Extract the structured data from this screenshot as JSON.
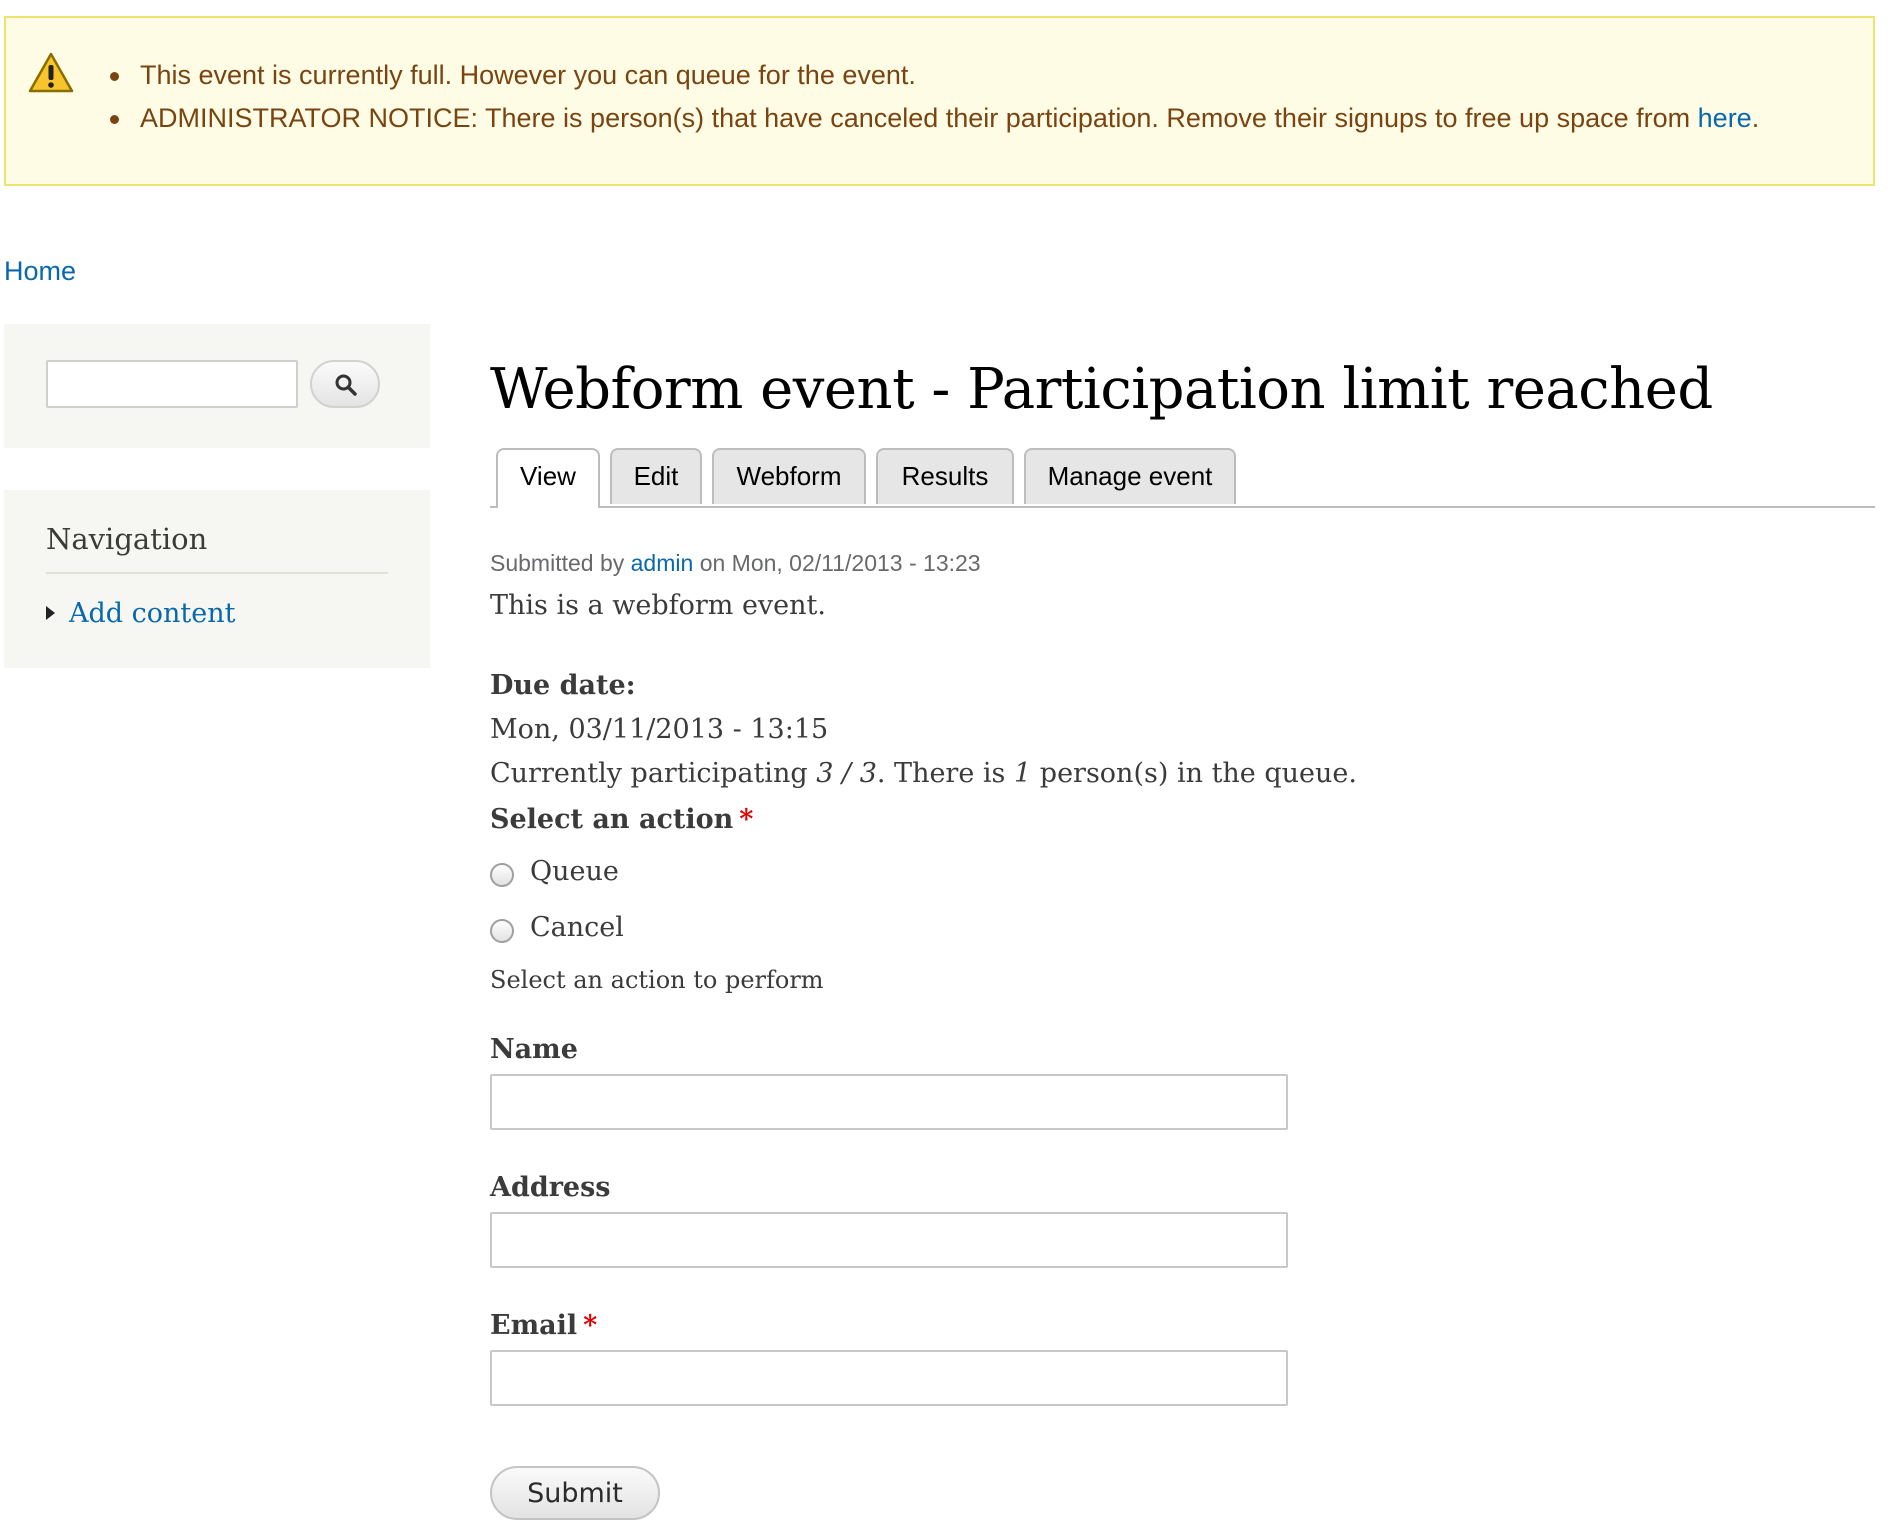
{
  "messages": {
    "type": "warning",
    "icon": "warning-icon",
    "items": [
      "This event is currently full. However you can queue for the event.",
      "ADMINISTRATOR NOTICE: There is person(s) that have canceled their participation. Remove their signups to free up space from"
    ],
    "link_text": "here",
    "after_link": "."
  },
  "breadcrumb": {
    "home": "Home"
  },
  "sidebar": {
    "search": {
      "value": "",
      "button_icon": "search-icon"
    },
    "navigation": {
      "title": "Navigation",
      "items": [
        {
          "label": "Add content"
        }
      ]
    }
  },
  "page": {
    "title": "Webform event - Participation limit reached",
    "tabs": [
      {
        "label": "View",
        "active": true
      },
      {
        "label": "Edit"
      },
      {
        "label": "Webform"
      },
      {
        "label": "Results"
      },
      {
        "label": "Manage event"
      }
    ],
    "submitted": {
      "prefix": "Submitted by",
      "author": "admin",
      "suffix": "on Mon, 02/11/2013 - 13:23"
    },
    "body": "This is a webform event.",
    "due_date_label": "Due date:",
    "due_date_value": "Mon, 03/11/2013 - 13:15",
    "participation": {
      "prefix": "Currently participating",
      "current": "3",
      "separator": "/",
      "limit": "3",
      "middle": ". There is",
      "queue": "1",
      "suffix": "person(s) in the queue."
    }
  },
  "form": {
    "action_label": "Select an action",
    "required_marker": "*",
    "options": [
      "Queue",
      "Cancel"
    ],
    "action_description": "Select an action to perform",
    "name_label": "Name",
    "name_value": "",
    "address_label": "Address",
    "address_value": "",
    "email_label": "Email",
    "email_value": "",
    "submit_label": "Submit"
  },
  "colors": {
    "warning_bg": "#fffce5",
    "warning_border": "#ede46f",
    "warning_text": "#7a4412",
    "link": "#0868ac",
    "required": "#e00000",
    "sidebar_bg": "#f6f6f2"
  }
}
